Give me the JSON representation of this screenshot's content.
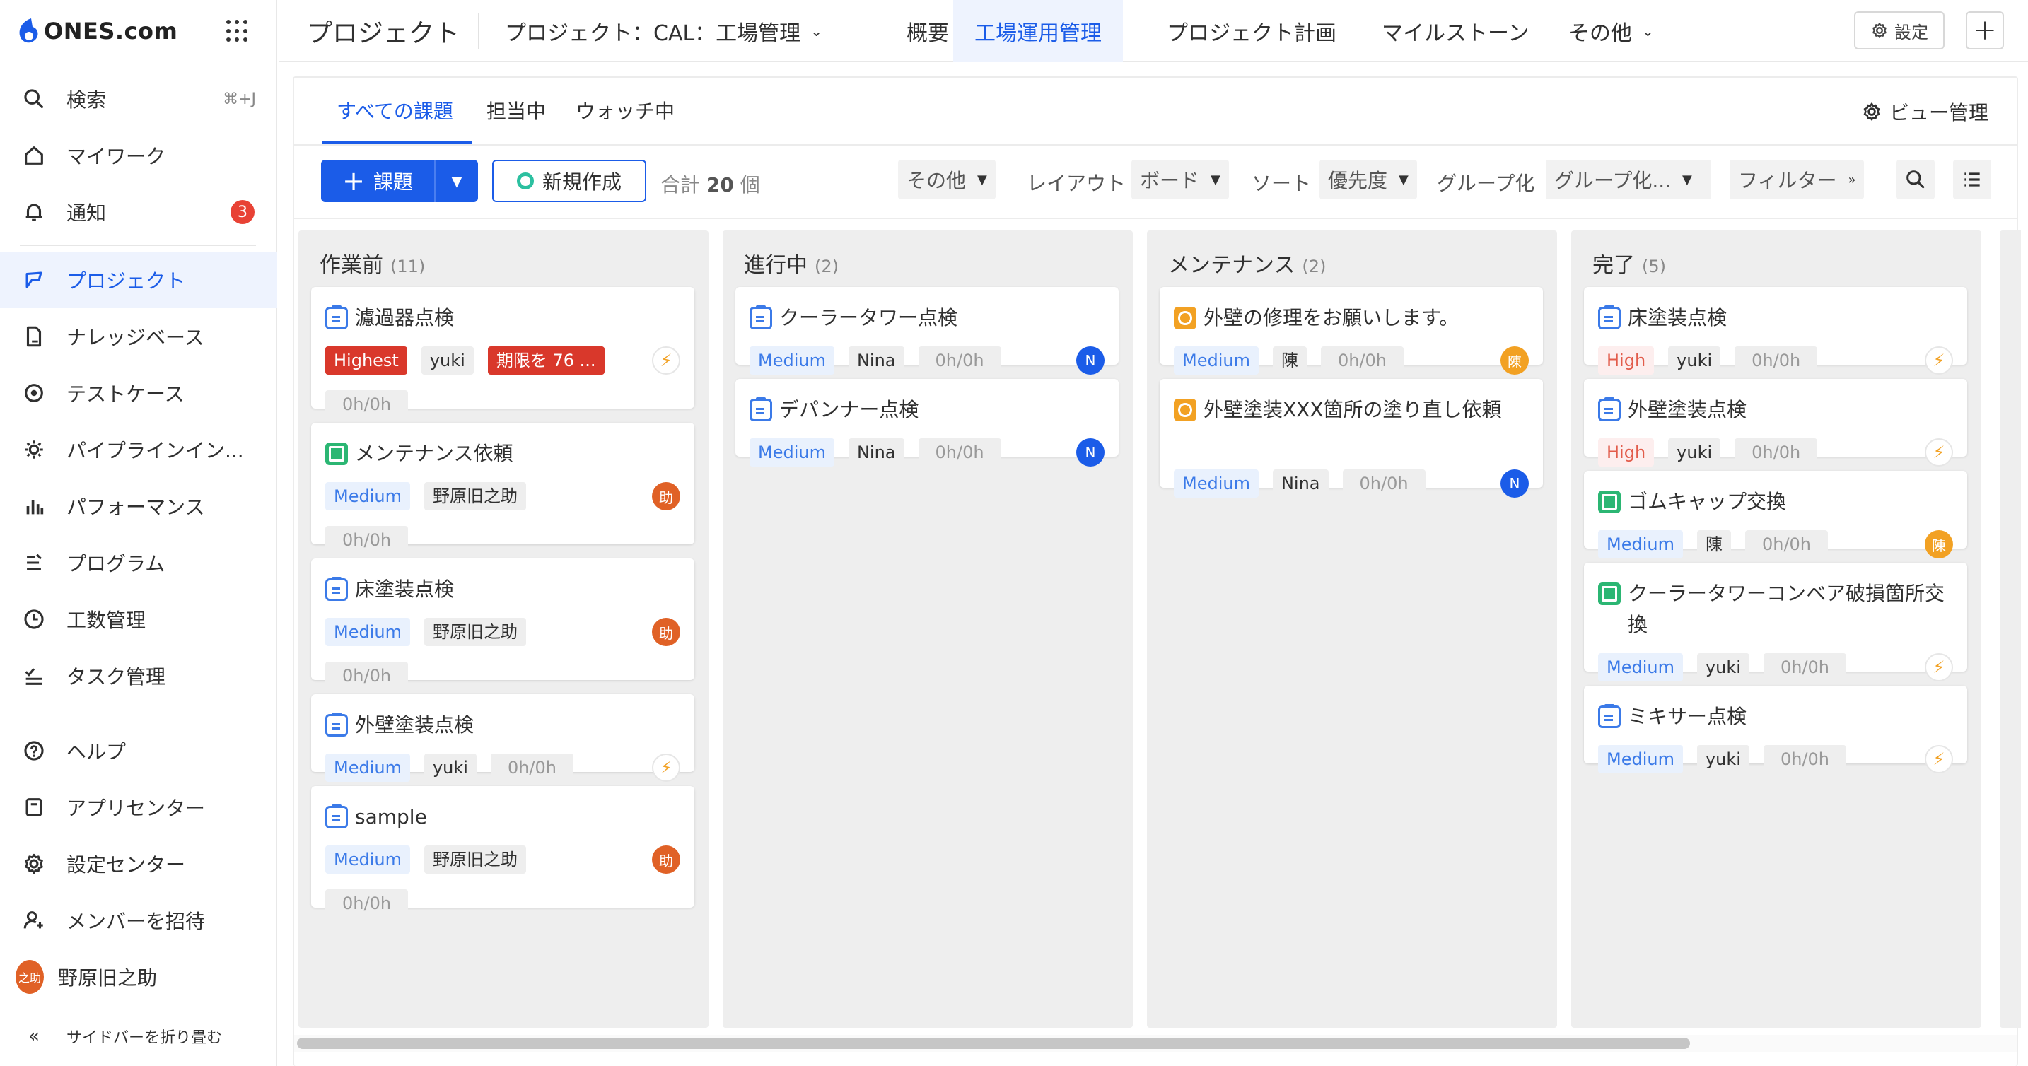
{
  "brand": {
    "logo_text": "ONES.com"
  },
  "sidebar": {
    "search": {
      "label": "検索",
      "shortcut": "⌘+J"
    },
    "items": [
      {
        "label": "マイワーク",
        "icon": "home-icon"
      },
      {
        "label": "通知",
        "icon": "bell-icon",
        "badge": "3"
      },
      {
        "label": "プロジェクト",
        "icon": "project-icon",
        "active": true
      },
      {
        "label": "ナレッジベース",
        "icon": "wiki-icon"
      },
      {
        "label": "テストケース",
        "icon": "testcase-icon"
      },
      {
        "label": "パイプラインイン...",
        "icon": "pipeline-icon"
      },
      {
        "label": "パフォーマンス",
        "icon": "chart-icon"
      },
      {
        "label": "プログラム",
        "icon": "program-icon"
      },
      {
        "label": "工数管理",
        "icon": "clock-icon"
      },
      {
        "label": "タスク管理",
        "icon": "tasklist-icon"
      }
    ],
    "bottom": [
      {
        "label": "ヘルプ",
        "icon": "help-icon"
      },
      {
        "label": "アプリセンター",
        "icon": "app-icon"
      },
      {
        "label": "設定センター",
        "icon": "gear-icon"
      },
      {
        "label": "メンバーを招待",
        "icon": "invite-icon"
      }
    ],
    "user": {
      "name": "野原旧之助",
      "avatar_text": "之助"
    },
    "collapse_label": "サイドバーを折り畳む"
  },
  "header": {
    "title": "プロジェクト",
    "project_selector": "プロジェクト：CAL：工場管理",
    "tabs": [
      {
        "label": "概要"
      },
      {
        "label": "工場運用管理",
        "active": true
      },
      {
        "label": "プロジェクト計画"
      },
      {
        "label": "マイルストーン"
      },
      {
        "label": "その他"
      }
    ],
    "settings_label": "設定"
  },
  "subtabs": [
    "すべての課題",
    "担当中",
    "ウォッチ中"
  ],
  "view_manager_label": "ビュー管理",
  "toolbar": {
    "new_issue_label": "課題",
    "create_label": "新規作成",
    "total_prefix": "合計",
    "total_count": "20",
    "total_suffix": "個",
    "other_label": "その他",
    "layout_label": "レイアウト",
    "layout_value": "ボード",
    "sort_label": "ソート",
    "sort_value": "優先度",
    "group_label": "グループ化",
    "group_value": "グループ化...",
    "filter_label": "フィルター"
  },
  "columns": [
    {
      "name": "作業前",
      "count": "(11)",
      "cards": [
        {
          "title": "濾過器点検",
          "type": "task",
          "priority": "Highest",
          "assignee": "yuki",
          "due": "期限を 76 ...",
          "hours": "0h/0h",
          "owner": "bolt",
          "owner_text": "⚡"
        },
        {
          "title": "メンテナンス依頼",
          "type": "maint",
          "priority": "Medium",
          "assignee": "野原旧之助",
          "hours": "0h/0h",
          "owner": "orange",
          "owner_text": "助"
        },
        {
          "title": "床塗装点検",
          "type": "task",
          "priority": "Medium",
          "assignee": "野原旧之助",
          "hours": "0h/0h",
          "owner": "orange",
          "owner_text": "助"
        },
        {
          "title": "外壁塗装点検",
          "type": "task",
          "priority": "Medium",
          "assignee": "yuki",
          "hours": "0h/0h",
          "owner": "bolt",
          "owner_text": "⚡"
        },
        {
          "title": "sample",
          "type": "task",
          "priority": "Medium",
          "assignee": "野原旧之助",
          "hours": "0h/0h",
          "owner": "orange",
          "owner_text": "助"
        }
      ]
    },
    {
      "name": "進行中",
      "count": "(2)",
      "cards": [
        {
          "title": "クーラータワー点検",
          "type": "task",
          "priority": "Medium",
          "assignee": "Nina",
          "hours": "0h/0h",
          "owner": "blue",
          "owner_text": "N"
        },
        {
          "title": "デパンナー点検",
          "type": "task",
          "priority": "Medium",
          "assignee": "Nina",
          "hours": "0h/0h",
          "owner": "blue",
          "owner_text": "N"
        }
      ]
    },
    {
      "name": "メンテナンス",
      "count": "(2)",
      "cards": [
        {
          "title": "外壁の修理をお願いします。",
          "type": "req",
          "priority": "Medium",
          "assignee": "陳",
          "hours": "0h/0h",
          "owner": "amber",
          "owner_text": "陳"
        },
        {
          "title": "外壁塗装XXX箇所の塗り直し依頼",
          "type": "req",
          "priority": "Medium",
          "assignee": "Nina",
          "hours": "0h/0h",
          "owner": "blue",
          "owner_text": "N"
        }
      ]
    },
    {
      "name": "完了",
      "count": "(5)",
      "cards": [
        {
          "title": "床塗装点検",
          "type": "task",
          "priority": "High",
          "assignee": "yuki",
          "hours": "0h/0h",
          "owner": "bolt",
          "owner_text": "⚡"
        },
        {
          "title": "外壁塗装点検",
          "type": "task",
          "priority": "High",
          "assignee": "yuki",
          "hours": "0h/0h",
          "owner": "bolt",
          "owner_text": "⚡"
        },
        {
          "title": "ゴムキャップ交換",
          "type": "maint",
          "priority": "Medium",
          "assignee": "陳",
          "hours": "0h/0h",
          "owner": "amber",
          "owner_text": "陳"
        },
        {
          "title": "クーラータワーコンベア破損箇所交換",
          "type": "maint",
          "priority": "Medium",
          "assignee": "yuki",
          "hours": "0h/0h",
          "owner": "bolt",
          "owner_text": "⚡"
        },
        {
          "title": "ミキサー点検",
          "type": "task",
          "priority": "Medium",
          "assignee": "yuki",
          "hours": "0h/0h",
          "owner": "bolt",
          "owner_text": "⚡"
        }
      ]
    }
  ],
  "colors": {
    "accent": "#1b5ce8",
    "danger": "#d9382b",
    "success": "#2bb673",
    "warning": "#f2a123"
  }
}
